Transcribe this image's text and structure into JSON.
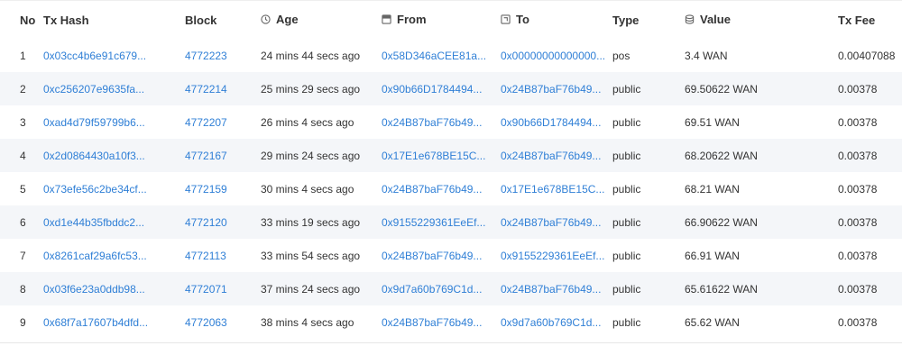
{
  "columns": {
    "no": "No",
    "tx_hash": "Tx Hash",
    "block": "Block",
    "age": "Age",
    "from": "From",
    "to": "To",
    "type": "Type",
    "value": "Value",
    "tx_fee": "Tx Fee"
  },
  "icons": {
    "age": "clock-icon",
    "from": "address-icon",
    "to": "address-icon",
    "value": "coins-icon"
  },
  "colors": {
    "link": "#2f7fd6",
    "stripe": "#f4f6f9"
  },
  "rows": [
    {
      "no": "1",
      "hash": "0x03cc4b6e91c679...",
      "block": "4772223",
      "age": "24 mins 44 secs ago",
      "from": "0x58D346aCEE81a...",
      "to": "0x00000000000000...",
      "type": "pos",
      "value": "3.4 WAN",
      "fee": "0.00407088"
    },
    {
      "no": "2",
      "hash": "0xc256207e9635fa...",
      "block": "4772214",
      "age": "25 mins 29 secs ago",
      "from": "0x90b66D1784494...",
      "to": "0x24B87baF76b49...",
      "type": "public",
      "value": "69.50622 WAN",
      "fee": "0.00378"
    },
    {
      "no": "3",
      "hash": "0xad4d79f59799b6...",
      "block": "4772207",
      "age": "26 mins 4 secs ago",
      "from": "0x24B87baF76b49...",
      "to": "0x90b66D1784494...",
      "type": "public",
      "value": "69.51 WAN",
      "fee": "0.00378"
    },
    {
      "no": "4",
      "hash": "0x2d0864430a10f3...",
      "block": "4772167",
      "age": "29 mins 24 secs ago",
      "from": "0x17E1e678BE15C...",
      "to": "0x24B87baF76b49...",
      "type": "public",
      "value": "68.20622 WAN",
      "fee": "0.00378"
    },
    {
      "no": "5",
      "hash": "0x73efe56c2be34cf...",
      "block": "4772159",
      "age": "30 mins 4 secs ago",
      "from": "0x24B87baF76b49...",
      "to": "0x17E1e678BE15C...",
      "type": "public",
      "value": "68.21 WAN",
      "fee": "0.00378"
    },
    {
      "no": "6",
      "hash": "0xd1e44b35fbddc2...",
      "block": "4772120",
      "age": "33 mins 19 secs ago",
      "from": "0x9155229361EeEf...",
      "to": "0x24B87baF76b49...",
      "type": "public",
      "value": "66.90622 WAN",
      "fee": "0.00378"
    },
    {
      "no": "7",
      "hash": "0x8261caf29a6fc53...",
      "block": "4772113",
      "age": "33 mins 54 secs ago",
      "from": "0x24B87baF76b49...",
      "to": "0x9155229361EeEf...",
      "type": "public",
      "value": "66.91 WAN",
      "fee": "0.00378"
    },
    {
      "no": "8",
      "hash": "0x03f6e23a0ddb98...",
      "block": "4772071",
      "age": "37 mins 24 secs ago",
      "from": "0x9d7a60b769C1d...",
      "to": "0x24B87baF76b49...",
      "type": "public",
      "value": "65.61622 WAN",
      "fee": "0.00378"
    },
    {
      "no": "9",
      "hash": "0x68f7a17607b4dfd...",
      "block": "4772063",
      "age": "38 mins 4 secs ago",
      "from": "0x24B87baF76b49...",
      "to": "0x9d7a60b769C1d...",
      "type": "public",
      "value": "65.62 WAN",
      "fee": "0.00378"
    }
  ]
}
